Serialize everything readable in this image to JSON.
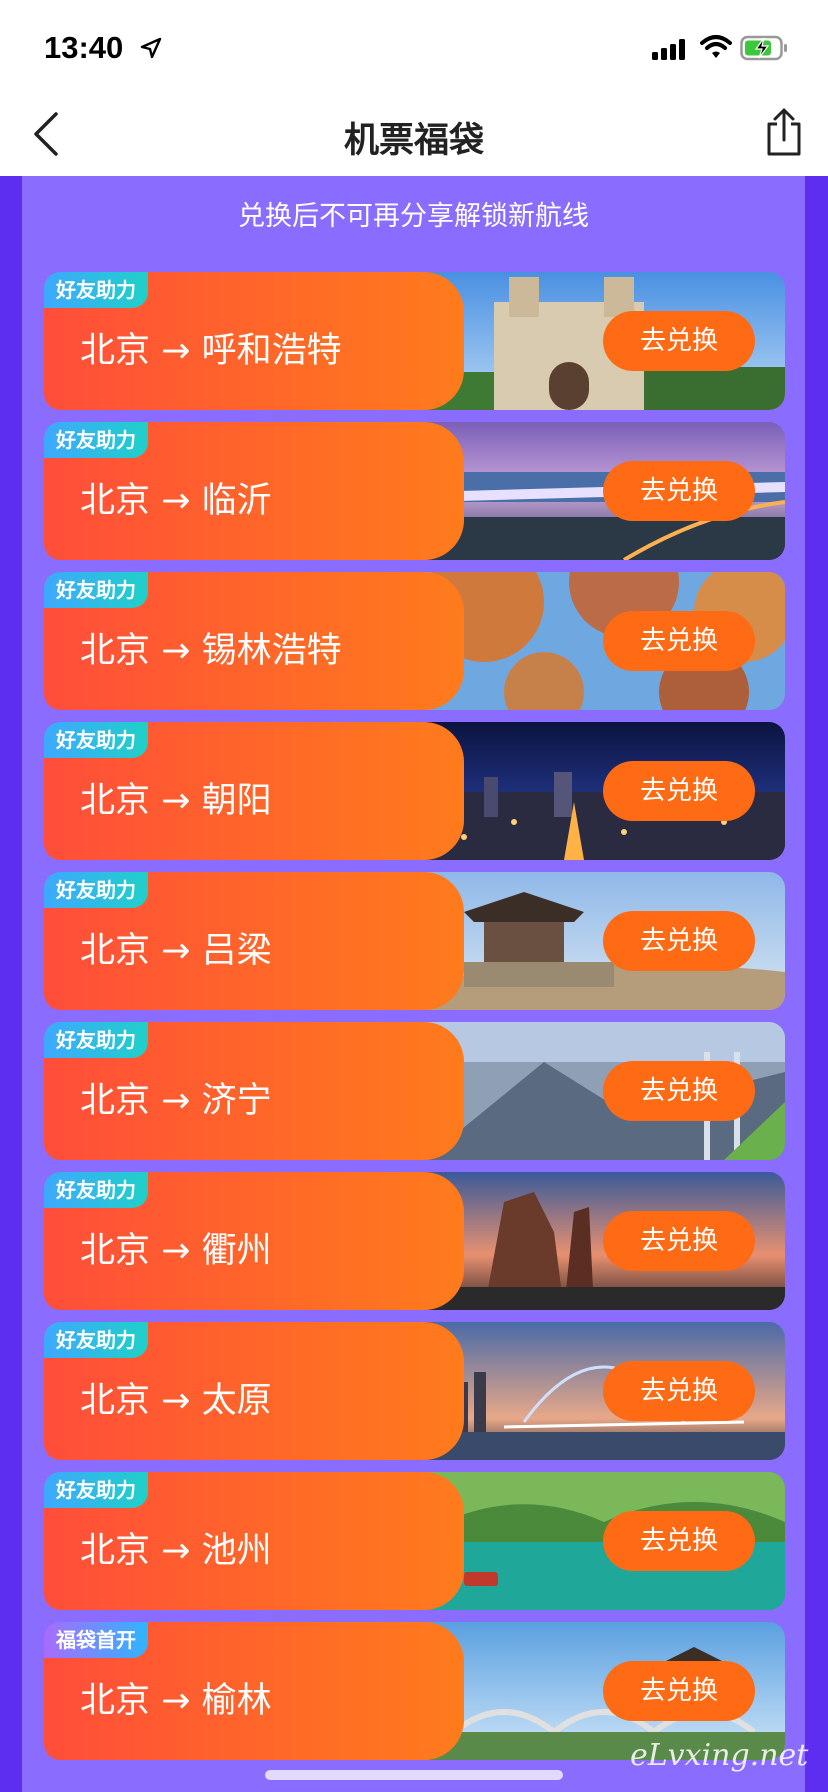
{
  "status": {
    "time": "13:40"
  },
  "nav": {
    "title": "机票福袋"
  },
  "notice": "兑换后不可再分享解锁新航线",
  "button_label": "去兑换",
  "routes": [
    {
      "tag": "好友助力",
      "route": "北京 → 呼和浩特"
    },
    {
      "tag": "好友助力",
      "route": "北京 → 临沂"
    },
    {
      "tag": "好友助力",
      "route": "北京 → 锡林浩特"
    },
    {
      "tag": "好友助力",
      "route": "北京 → 朝阳"
    },
    {
      "tag": "好友助力",
      "route": "北京 → 吕梁"
    },
    {
      "tag": "好友助力",
      "route": "北京 → 济宁"
    },
    {
      "tag": "好友助力",
      "route": "北京 → 衢州"
    },
    {
      "tag": "好友助力",
      "route": "北京 → 太原"
    },
    {
      "tag": "好友助力",
      "route": "北京 → 池州"
    },
    {
      "tag": "福袋首开",
      "route": "北京 → 榆林"
    }
  ],
  "watermark": "eLvxing.net"
}
